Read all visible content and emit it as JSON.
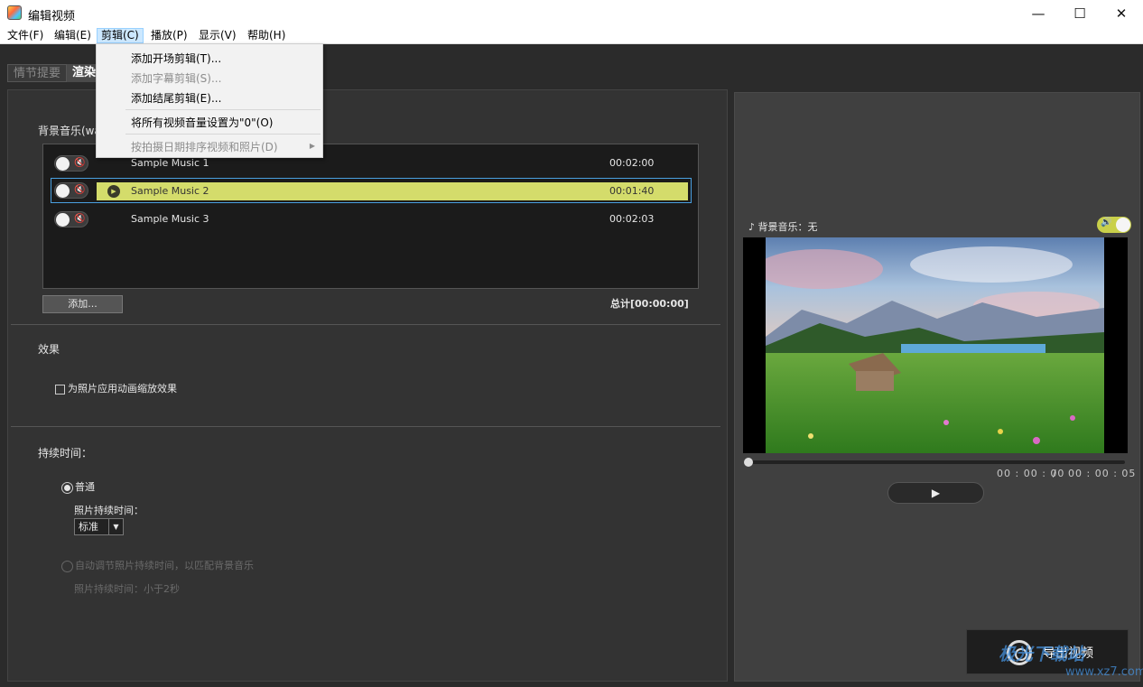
{
  "window": {
    "title": "编辑视频",
    "minimize": "—",
    "maximize": "☐",
    "close": "✕"
  },
  "menubar": [
    {
      "label": "文件(F)"
    },
    {
      "label": "编辑(E)"
    },
    {
      "label": "剪辑(C)"
    },
    {
      "label": "播放(P)"
    },
    {
      "label": "显示(V)"
    },
    {
      "label": "帮助(H)"
    }
  ],
  "dropdown": {
    "items": [
      {
        "label": "添加开场剪辑(T)...",
        "enabled": true
      },
      {
        "label": "添加字幕剪辑(S)...",
        "enabled": false
      },
      {
        "label": "添加结尾剪辑(E)...",
        "enabled": true
      },
      {
        "label": "将所有视频音量设置为\"0\"(O)",
        "enabled": true
      },
      {
        "label": "按拍摄日期排序视频和照片(D)",
        "enabled": false,
        "submenu": true
      }
    ]
  },
  "tabs": {
    "inactive": "情节提要",
    "active": "渲染"
  },
  "music": {
    "section_label": "背景音乐(wa",
    "rows": [
      {
        "name": "Sample Music 1",
        "duration": "00:02:00",
        "selected": false
      },
      {
        "name": "Sample Music 2",
        "duration": "00:01:40",
        "selected": true
      },
      {
        "name": "Sample Music 3",
        "duration": "00:02:03",
        "selected": false
      }
    ],
    "add_button": "添加...",
    "total": "总计[00:00:00]"
  },
  "effects": {
    "section_label": "效果",
    "checkbox_label": "为照片应用动画缩放效果",
    "checked": false
  },
  "duration": {
    "section_label": "持续时间：",
    "option_normal": "普通",
    "photo_duration_label": "照片持续时间：",
    "select_value": "标准",
    "option_auto": "自动调节照片持续时间，以匹配背景音乐",
    "auto_photo_duration": "照片持续时间：小于2秒"
  },
  "preview": {
    "bgm_label": "背景音乐：无",
    "music_note_icon": "music-note-icon",
    "time_current": "00 : 00 : 00",
    "time_sep": "/",
    "time_total": "00 : 00 : 05",
    "play_glyph": "▶",
    "progress": 0
  },
  "export": {
    "label": "导出视频"
  },
  "watermark": {
    "text": "极光下载站",
    "url": "www.xz7.com"
  },
  "colors": {
    "selection": "#d4dc6b",
    "accent_toggle": "#c9d04a",
    "selection_border": "#4aa0e0"
  }
}
